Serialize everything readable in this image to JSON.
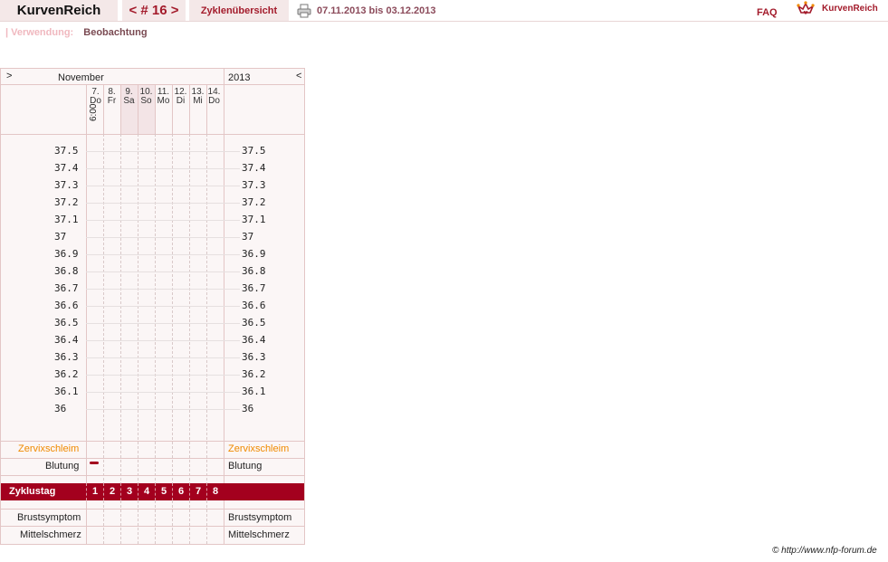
{
  "header": {
    "app_name": "KurvenReich",
    "cycle_nav": "< # 16 >",
    "overview_label": "Zyklenübersicht",
    "date_range": "07.11.2013 bis 03.12.2013",
    "faq_label": "FAQ",
    "logo_text": "KurvenReich",
    "printer_icon": "printer-icon",
    "logo_icon": "crown-heart-icon"
  },
  "usage": {
    "label": "| Verwendung:",
    "value": "Beobachtung"
  },
  "chart": {
    "nav_prev": ">",
    "month": "November",
    "year": "2013",
    "nav_next": "<",
    "days": [
      {
        "num": "7.",
        "wd": "Do"
      },
      {
        "num": "8.",
        "wd": "Fr"
      },
      {
        "num": "9.",
        "wd": "Sa"
      },
      {
        "num": "10.",
        "wd": "So"
      },
      {
        "num": "11.",
        "wd": "Mo"
      },
      {
        "num": "12.",
        "wd": "Di"
      },
      {
        "num": "13.",
        "wd": "Mi"
      },
      {
        "num": "14.",
        "wd": "Do"
      }
    ],
    "time_label": "6:00",
    "temps": [
      "37.5",
      "37.4",
      "37.3",
      "37.2",
      "37.1",
      "37",
      "36.9",
      "36.8",
      "36.7",
      "36.6",
      "36.5",
      "36.4",
      "36.3",
      "36.2",
      "36.1",
      "36"
    ],
    "rows": {
      "cervix": "Zervixschleim",
      "bleeding": "Blutung",
      "cycle_day": "Zyklustag",
      "breast": "Brustsymptom",
      "midpain": "Mittelschmerz"
    },
    "cycle_days": [
      "1",
      "2",
      "3",
      "4",
      "5",
      "6",
      "7",
      "8"
    ],
    "bleeding_day_index": 0
  },
  "footer": {
    "copyright": "© http://www.nfp-forum.de"
  },
  "colors": {
    "accent": "#a3001e",
    "orange": "#f08a00",
    "tab_bg": "#f4e8e8",
    "grid": "#e3c6c6"
  }
}
